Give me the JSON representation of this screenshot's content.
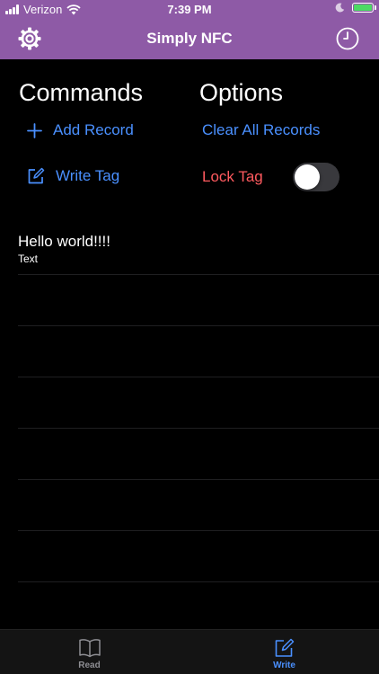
{
  "colors": {
    "brand": "#8e5aa6",
    "link": "#4a90ff",
    "danger": "#ff5a5f",
    "inactive": "#8e8e93"
  },
  "status_bar": {
    "carrier": "Verizon",
    "time": "7:39 PM",
    "icons": [
      "signal-icon",
      "wifi-icon",
      "moon-icon",
      "battery-icon",
      "charging-bolt-icon"
    ]
  },
  "nav": {
    "title": "Simply NFC",
    "left_icon": "gear-icon",
    "right_icon": "clock-icon"
  },
  "commands": {
    "title": "Commands",
    "add_record": "Add Record",
    "write_tag": "Write Tag"
  },
  "options": {
    "title": "Options",
    "clear_all": "Clear All Records",
    "lock_tag": "Lock Tag",
    "lock_tag_on": false
  },
  "records": [
    {
      "title": "Hello world!!!!",
      "type": "Text"
    }
  ],
  "tabs": [
    {
      "label": "Read",
      "icon": "book-icon",
      "selected": false
    },
    {
      "label": "Write",
      "icon": "compose-icon",
      "selected": true
    }
  ]
}
